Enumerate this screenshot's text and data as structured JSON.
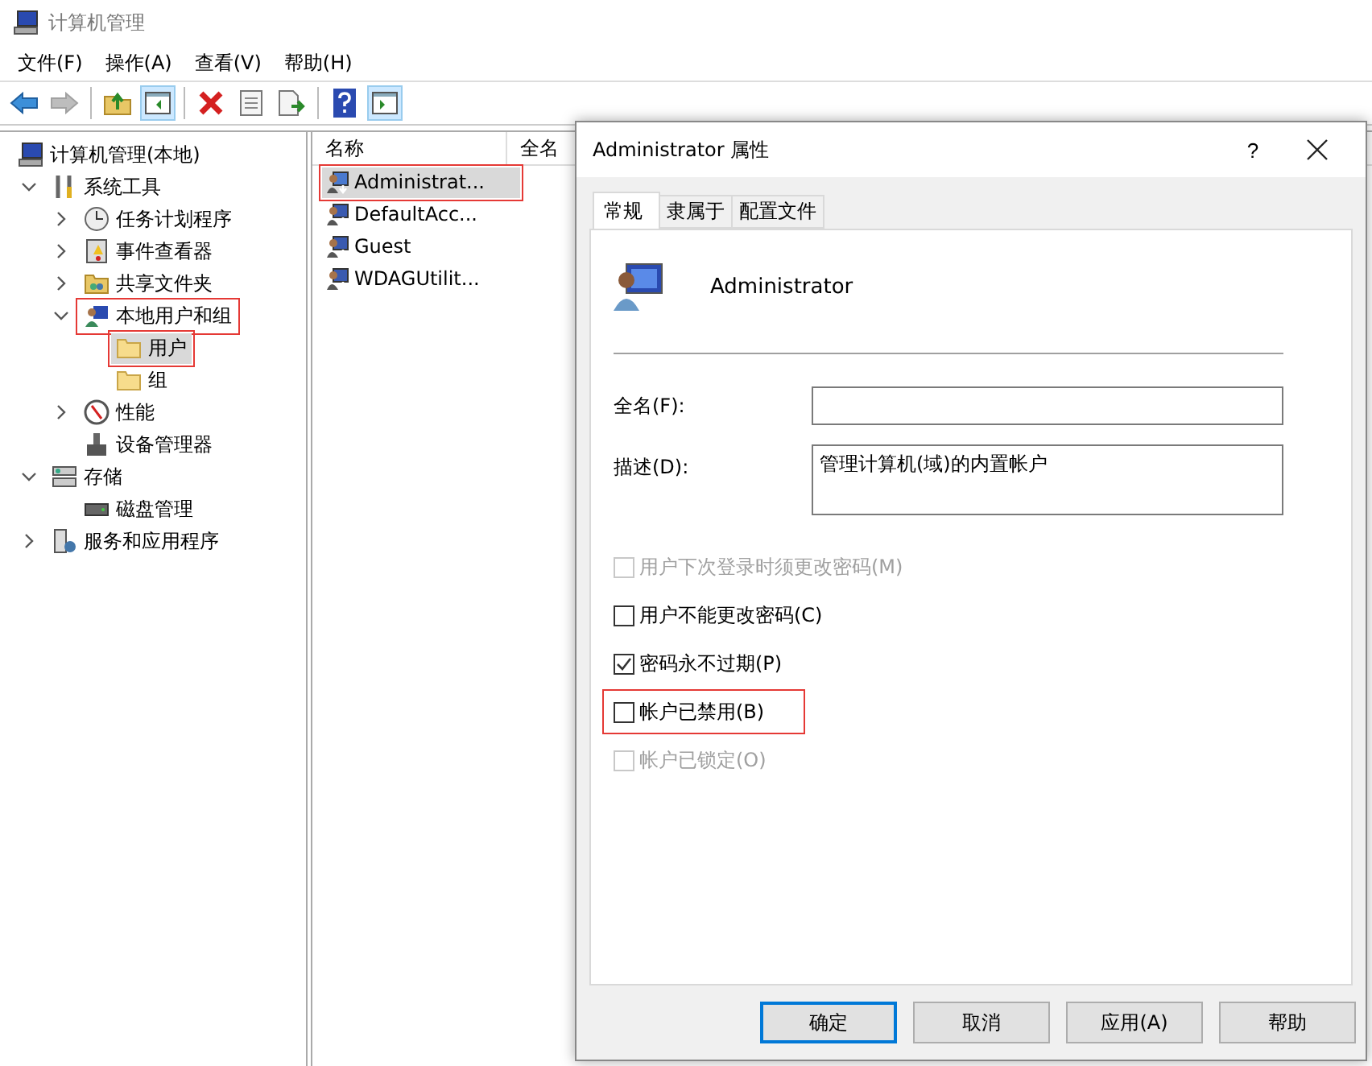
{
  "window": {
    "title": "计算机管理"
  },
  "menu": [
    "文件(F)",
    "操作(A)",
    "查看(V)",
    "帮助(H)"
  ],
  "toolbar": [
    {
      "kind": "back",
      "pressed": false,
      "disabled": false
    },
    {
      "kind": "forward",
      "pressed": false,
      "disabled": true
    },
    {
      "kind": "separator"
    },
    {
      "kind": "up",
      "pressed": false,
      "disabled": false
    },
    {
      "kind": "tree-pane",
      "pressed": true,
      "disabled": false
    },
    {
      "kind": "separator"
    },
    {
      "kind": "delete",
      "pressed": false,
      "disabled": false
    },
    {
      "kind": "properties",
      "pressed": false,
      "disabled": false
    },
    {
      "kind": "export",
      "pressed": false,
      "disabled": false
    },
    {
      "kind": "separator"
    },
    {
      "kind": "help",
      "pressed": false,
      "disabled": false
    },
    {
      "kind": "action-pane",
      "pressed": true,
      "disabled": false
    }
  ],
  "tree": [
    {
      "label": "计算机管理(本地)",
      "selected": false,
      "marked": false,
      "children": [
        {
          "label": "系统工具",
          "expanded": true,
          "selected": false,
          "marked": false,
          "children": [
            {
              "label": "任务计划程序",
              "expanded": false,
              "selected": false,
              "marked": false
            },
            {
              "label": "事件查看器",
              "expanded": false,
              "selected": false,
              "marked": false
            },
            {
              "label": "共享文件夹",
              "expanded": false,
              "selected": false,
              "marked": false
            },
            {
              "label": "本地用户和组",
              "expanded": true,
              "selected": false,
              "marked": true,
              "children": [
                {
                  "label": "用户",
                  "selected": true,
                  "marked": true
                },
                {
                  "label": "组",
                  "selected": false,
                  "marked": false
                }
              ]
            },
            {
              "label": "性能",
              "expanded": false,
              "selected": false,
              "marked": false
            },
            {
              "label": "设备管理器",
              "selected": false,
              "marked": false
            }
          ]
        },
        {
          "label": "存储",
          "expanded": true,
          "selected": false,
          "marked": false,
          "children": [
            {
              "label": "磁盘管理",
              "selected": false,
              "marked": false
            }
          ]
        },
        {
          "label": "服务和应用程序",
          "expanded": false,
          "selected": false,
          "marked": false
        }
      ]
    }
  ],
  "list": {
    "columns": [
      "名称",
      "全名"
    ],
    "rows": [
      {
        "name": "Administrat...",
        "selected": true,
        "marked": true
      },
      {
        "name": "DefaultAcc...",
        "selected": false,
        "marked": false
      },
      {
        "name": "Guest",
        "selected": false,
        "marked": false
      },
      {
        "name": "WDAGUtilit...",
        "selected": false,
        "marked": false
      }
    ]
  },
  "dialog": {
    "title": "Administrator 属性",
    "help": "?",
    "tabs": [
      {
        "label": "常规",
        "selected": true
      },
      {
        "label": "隶属于",
        "selected": false
      },
      {
        "label": "配置文件",
        "selected": false
      }
    ],
    "user_name": "Administrator",
    "fields": [
      {
        "label": "全名(F):",
        "kind": "single"
      },
      {
        "label": "描述(D):",
        "kind": "multiline",
        "value": "管理计算机(域)的内置帐户"
      }
    ],
    "checkboxes": [
      {
        "label": "用户下次登录时须更改密码(M)",
        "checked": false,
        "disabled": true,
        "marked": false
      },
      {
        "label": "用户不能更改密码(C)",
        "checked": false,
        "disabled": false,
        "marked": false
      },
      {
        "label": "密码永不过期(P)",
        "checked": true,
        "disabled": false,
        "marked": false
      },
      {
        "label": "帐户已禁用(B)",
        "checked": false,
        "disabled": false,
        "marked": true
      },
      {
        "label": "帐户已锁定(O)",
        "checked": false,
        "disabled": true,
        "marked": false
      }
    ],
    "buttons": [
      {
        "label": "确定",
        "default": true
      },
      {
        "label": "取消",
        "default": false
      },
      {
        "label": "应用(A)",
        "default": false
      },
      {
        "label": "帮助",
        "default": false
      }
    ]
  }
}
